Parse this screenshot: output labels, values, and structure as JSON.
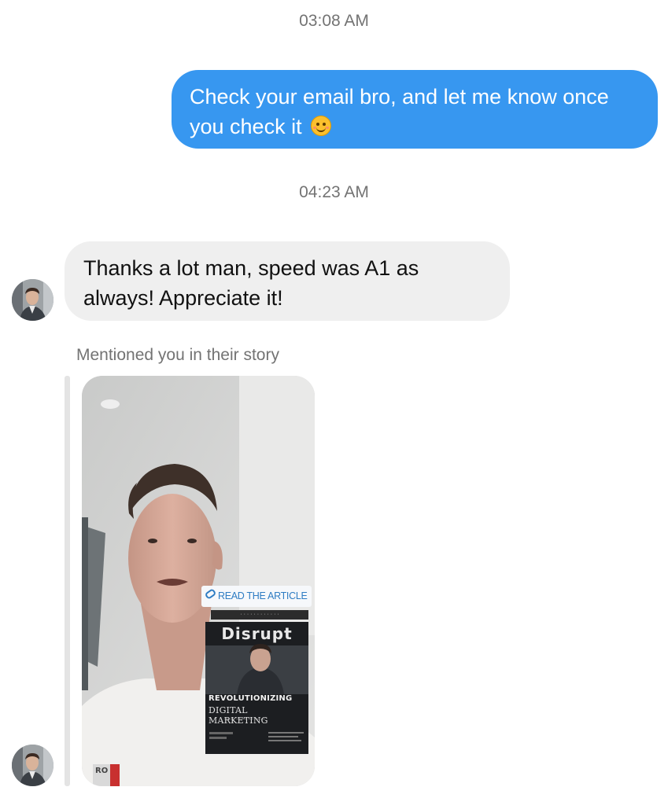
{
  "thread": {
    "timestamp_1": "03:08 AM",
    "outgoing_message": {
      "line_1": "Check your email bro, and let me know once",
      "line_2": "you check it",
      "emoji": "smiling-face-emoji"
    },
    "timestamp_2": "04:23 AM",
    "incoming_message": {
      "line_1": "Thanks a lot man, speed was A1 as",
      "line_2": "always! Appreciate it!"
    },
    "story_mention": {
      "caption": "Mentioned you in their story",
      "read_button": "READ THE ARTICLE",
      "magazine_title": "Disrupt",
      "magazine_headline_1": "REVOLUTIONIZING",
      "magazine_headline_2": "DIGITAL MARKETING",
      "shirt_logo_text": "RO"
    }
  },
  "colors": {
    "outgoing_bubble": "#3797f0",
    "incoming_bubble": "#efefef",
    "timestamp_text": "#737373"
  },
  "icons": {
    "avatar": "user-avatar",
    "link": "link-icon"
  }
}
